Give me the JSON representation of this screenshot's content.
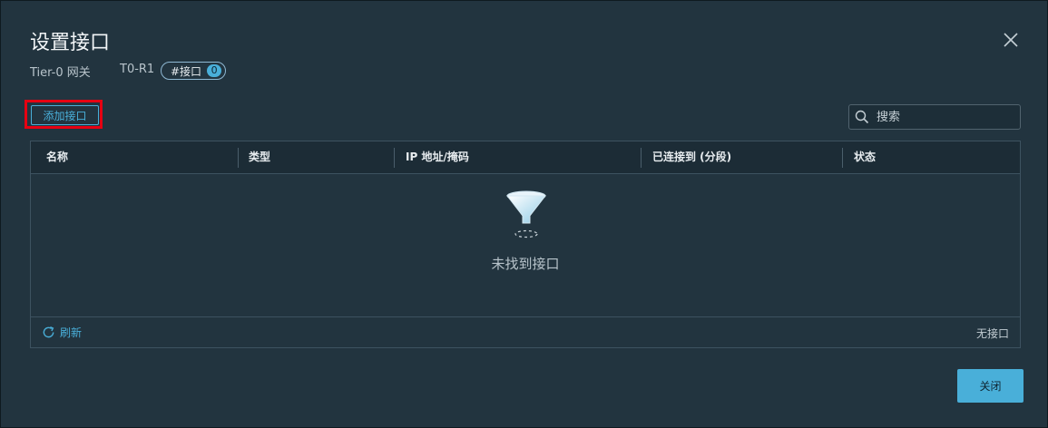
{
  "dialog": {
    "title": "设置接口",
    "gateway_label": "Tier-0 网关",
    "gateway_name": "T0-R1",
    "tag_label": "#接口",
    "tag_count": "0"
  },
  "toolbar": {
    "add_label": "添加接口",
    "search_placeholder": "搜索"
  },
  "grid": {
    "columns": [
      "名称",
      "类型",
      "IP 地址/掩码",
      "已连接到 (分段)",
      "状态"
    ],
    "empty_text": "未找到接口",
    "refresh_label": "刷新",
    "footer_count": "无接口"
  },
  "footer": {
    "close_label": "关闭"
  },
  "icons": {
    "close": "close-icon",
    "search": "search-icon",
    "refresh": "refresh-icon",
    "empty": "funnel-icon"
  },
  "colors": {
    "accent": "#49afd9",
    "highlight": "#e60012",
    "background": "#22343f"
  }
}
